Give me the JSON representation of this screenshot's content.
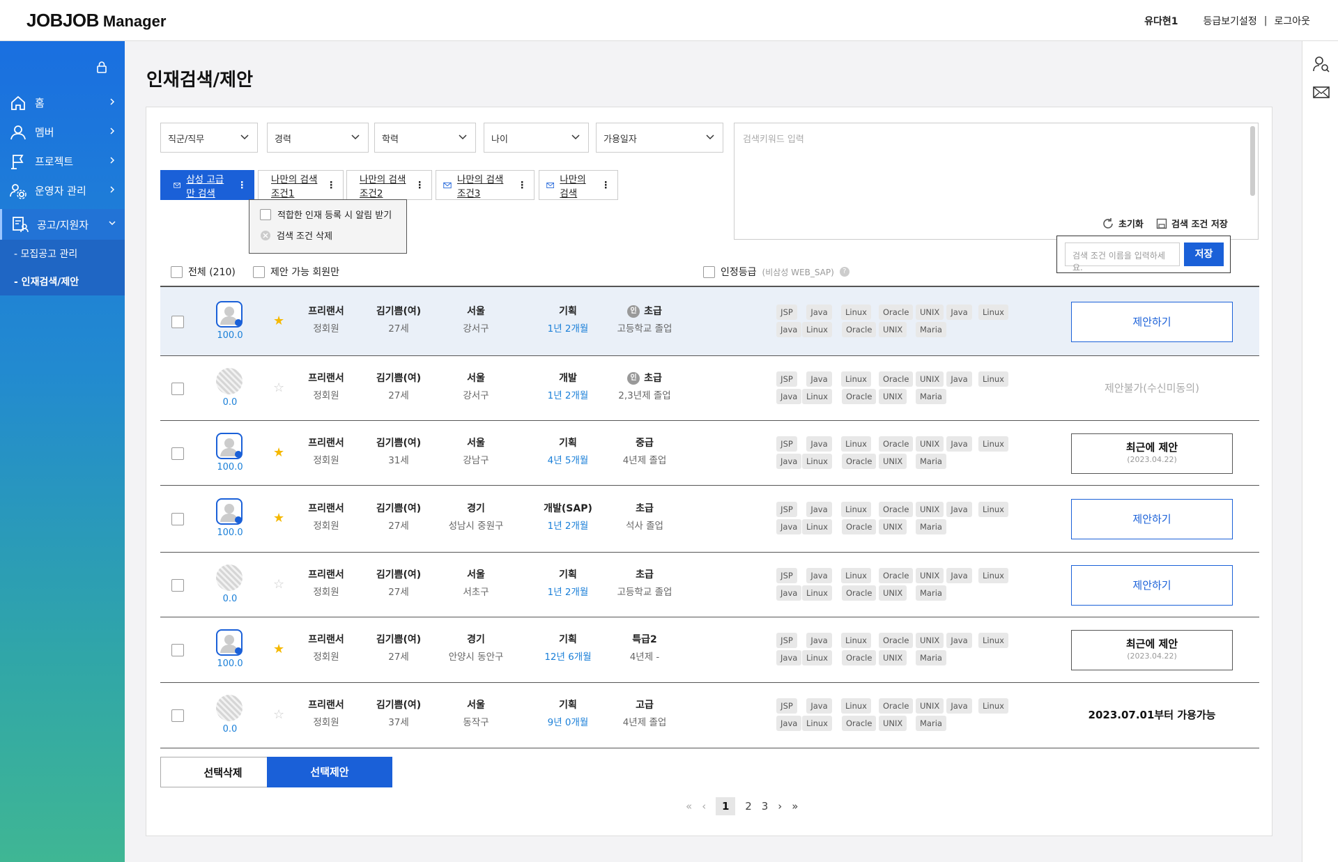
{
  "app": {
    "logo": "JOBJOB",
    "logo_sub": "Manager"
  },
  "top": {
    "user": "유다현1",
    "link1": "등급보기설정",
    "sep": "|",
    "link2": "로그아웃"
  },
  "sidebar": {
    "items": [
      {
        "label": "홈"
      },
      {
        "label": "멤버"
      },
      {
        "label": "프로젝트"
      },
      {
        "label": "운영자 관리"
      },
      {
        "label": "공고/지원자"
      }
    ],
    "sub": [
      {
        "label": "- 모집공고 관리"
      },
      {
        "label": "- 인재검색/제안"
      }
    ]
  },
  "page": {
    "title": "인재검색/제안"
  },
  "filters": {
    "selects": [
      "직군/직무",
      "경력",
      "학력",
      "나이",
      "가용일자"
    ],
    "keyword_placeholder": "검색키워드 입력",
    "reset": "초기화",
    "save_cond": "검색 조건 저장"
  },
  "chips": [
    {
      "label": "삼성 고급만 검색",
      "dots": "⋮"
    },
    {
      "label": "나만의 검색조건1",
      "dots": "⋮"
    },
    {
      "label": "나만의 검색조건2",
      "dots": "⋮"
    },
    {
      "label": "나만의 검색조건3",
      "dots": "⋮"
    },
    {
      "label": "나만의 검색",
      "dots": "⋮"
    }
  ],
  "popup": {
    "opt1": "적합한 인재 등록 시 알림 받기",
    "opt2": "검색 조건 삭제"
  },
  "checks": {
    "all": "전체 (210)",
    "proposable": "제안 가능 회원만",
    "cert": "인정등급",
    "cert_note": "(비삼성 WEB_SAP)",
    "help": "?"
  },
  "savebox": {
    "placeholder": "검색 조건 이름을 입력하세요.",
    "button": "저장"
  },
  "rows": [
    {
      "score": "100.0",
      "star": true,
      "type": "프리랜서",
      "member": "정회원",
      "name": "김기쁨(여)",
      "age": "27세",
      "region": "서울",
      "district": "강서구",
      "role": "기획",
      "exp": "1년 2개월",
      "badge": "인",
      "grade": "초급",
      "edu": "고등학교 졸업",
      "action": "제안하기",
      "action_type": "propose"
    },
    {
      "score": "0.0",
      "star": false,
      "type": "프리랜서",
      "member": "정회원",
      "name": "김기쁨(여)",
      "age": "27세",
      "region": "서울",
      "district": "강서구",
      "role": "개발",
      "exp": "1년 2개월",
      "badge": "인",
      "grade": "초급",
      "edu": "2,3년제 졸업",
      "action": "제안불가(수신미동의)",
      "action_type": "na"
    },
    {
      "score": "100.0",
      "star": true,
      "type": "프리랜서",
      "member": "정회원",
      "name": "김기쁨(여)",
      "age": "31세",
      "region": "서울",
      "district": "강남구",
      "role": "기획",
      "exp": "4년 5개월",
      "badge": "",
      "grade": "중급",
      "edu": "4년제 졸업",
      "action": "최근에 제안",
      "action_date": "(2023.04.22)",
      "action_type": "recent"
    },
    {
      "score": "100.0",
      "star": true,
      "type": "프리랜서",
      "member": "정회원",
      "name": "김기쁨(여)",
      "age": "27세",
      "region": "경기",
      "district": "성남시 중원구",
      "role": "개발(SAP)",
      "exp": "1년 2개월",
      "badge": "",
      "grade": "초급",
      "edu": "석사 졸업",
      "action": "제안하기",
      "action_type": "propose"
    },
    {
      "score": "0.0",
      "star": false,
      "type": "프리랜서",
      "member": "정회원",
      "name": "김기쁨(여)",
      "age": "27세",
      "region": "서울",
      "district": "서초구",
      "role": "기획",
      "exp": "1년 2개월",
      "badge": "",
      "grade": "초급",
      "edu": "고등학교 졸업",
      "action": "제안하기",
      "action_type": "propose"
    },
    {
      "score": "100.0",
      "star": true,
      "type": "프리랜서",
      "member": "정회원",
      "name": "김기쁨(여)",
      "age": "27세",
      "region": "경기",
      "district": "안양시 동안구",
      "role": "기획",
      "exp": "12년 6개월",
      "badge": "",
      "grade": "특급2",
      "edu": "4년제 -",
      "action": "최근에 제안",
      "action_date": "(2023.04.22)",
      "action_type": "recent"
    },
    {
      "score": "0.0",
      "star": false,
      "type": "프리랜서",
      "member": "정회원",
      "name": "김기쁨(여)",
      "age": "37세",
      "region": "서울",
      "district": "동작구",
      "role": "기획",
      "exp": "9년 0개월",
      "badge": "",
      "grade": "고급",
      "edu": "4년제 졸업",
      "action": "2023.07.01부터 가용가능",
      "action_type": "plain"
    }
  ],
  "tags_line1": [
    "JSP",
    "Java",
    "Linux",
    "Oracle",
    "UNIX",
    "Java",
    "Linux"
  ],
  "tags_line2": [
    "Java",
    "Linux",
    "Oracle",
    "UNIX",
    "Maria"
  ],
  "bottom": {
    "delete": "선택삭제",
    "propose": "선택제안"
  },
  "pager": {
    "pages": [
      "1",
      "2",
      "3"
    ],
    "first": "«",
    "prev": "‹",
    "next": "›",
    "last": "»"
  },
  "colors": {
    "primary": "#1a60d8",
    "link_blue": "#1a7fd8",
    "star": "#f5b800"
  }
}
